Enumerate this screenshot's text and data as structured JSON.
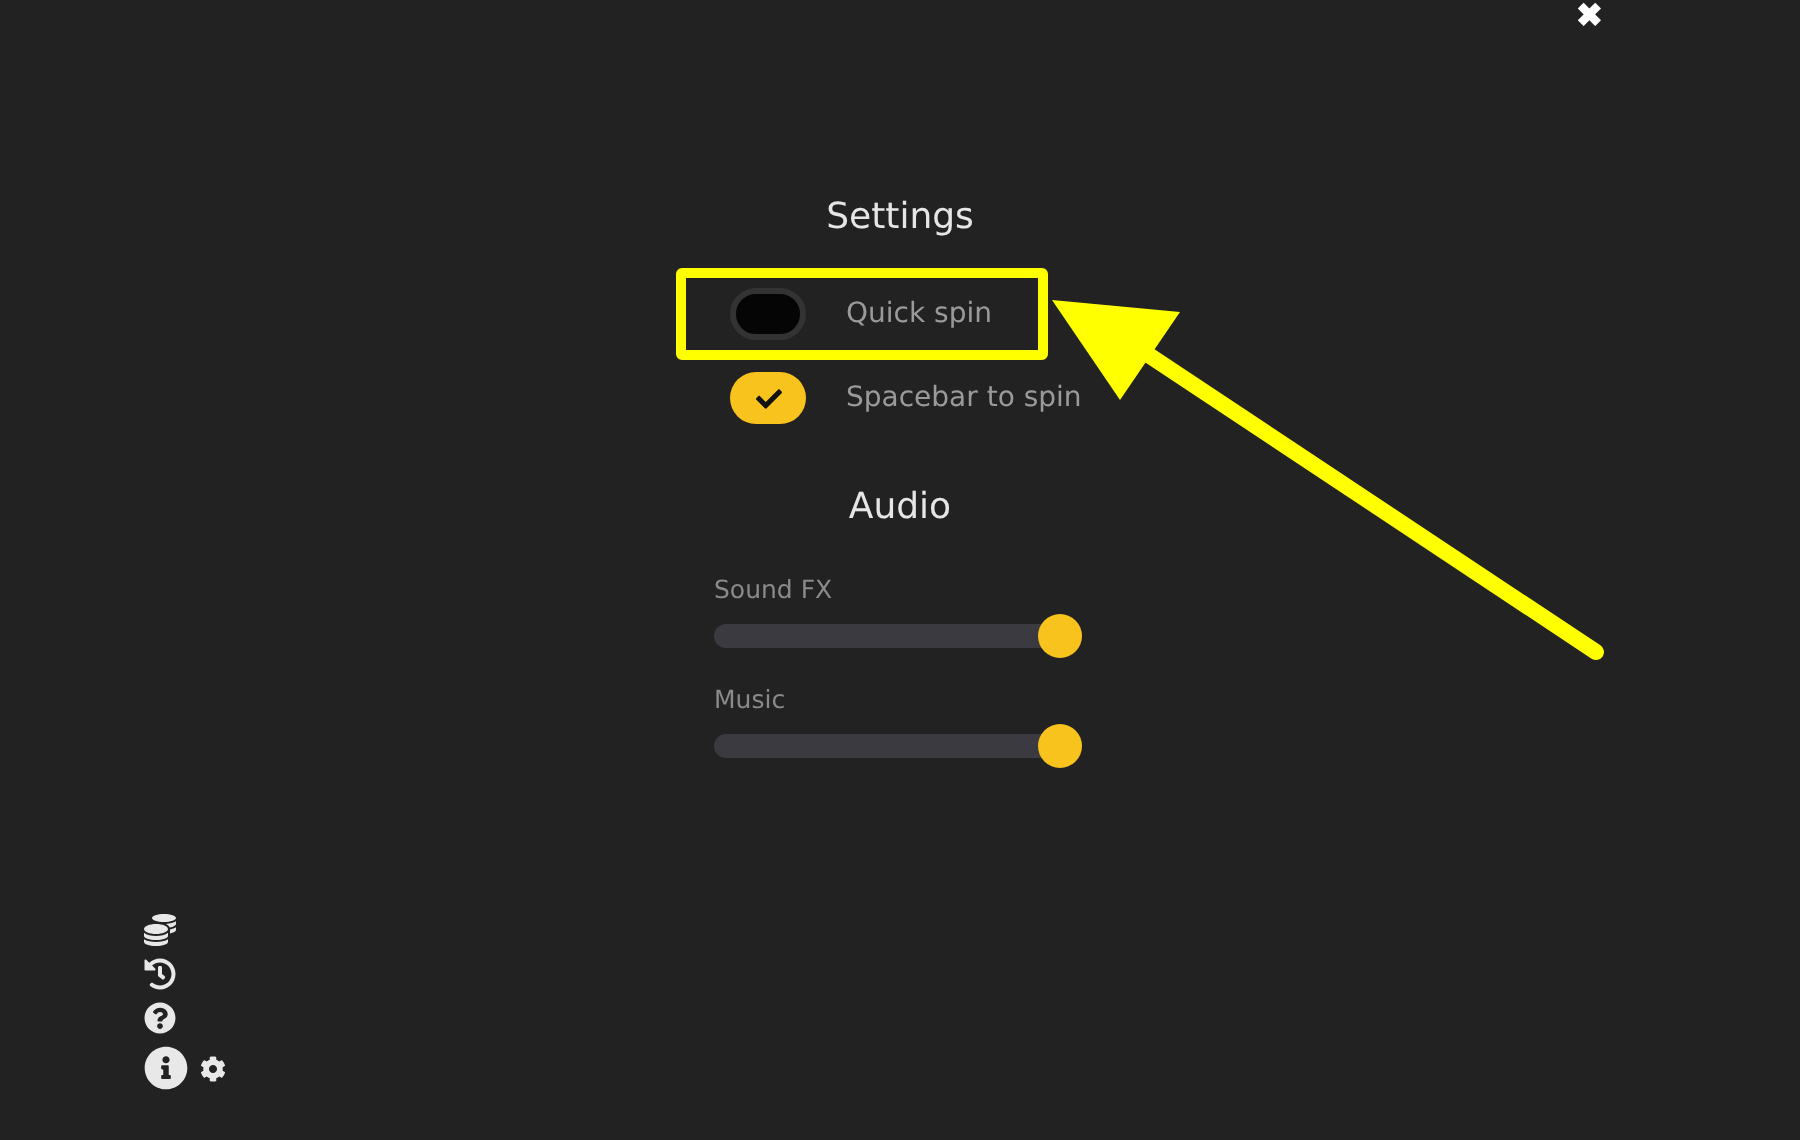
{
  "close_label": "✖",
  "settings": {
    "title": "Settings",
    "toggles": [
      {
        "label": "Quick spin",
        "on": false,
        "highlighted": true
      },
      {
        "label": "Spacebar to spin",
        "on": true,
        "highlighted": false
      }
    ]
  },
  "audio": {
    "title": "Audio",
    "sliders": [
      {
        "label": "Sound FX",
        "level": 1
      },
      {
        "label": "Music",
        "level": 1
      }
    ]
  },
  "side_icons": [
    {
      "kind": "paytable"
    },
    {
      "kind": "history"
    },
    {
      "kind": "help"
    },
    {
      "kind": "info"
    }
  ]
}
